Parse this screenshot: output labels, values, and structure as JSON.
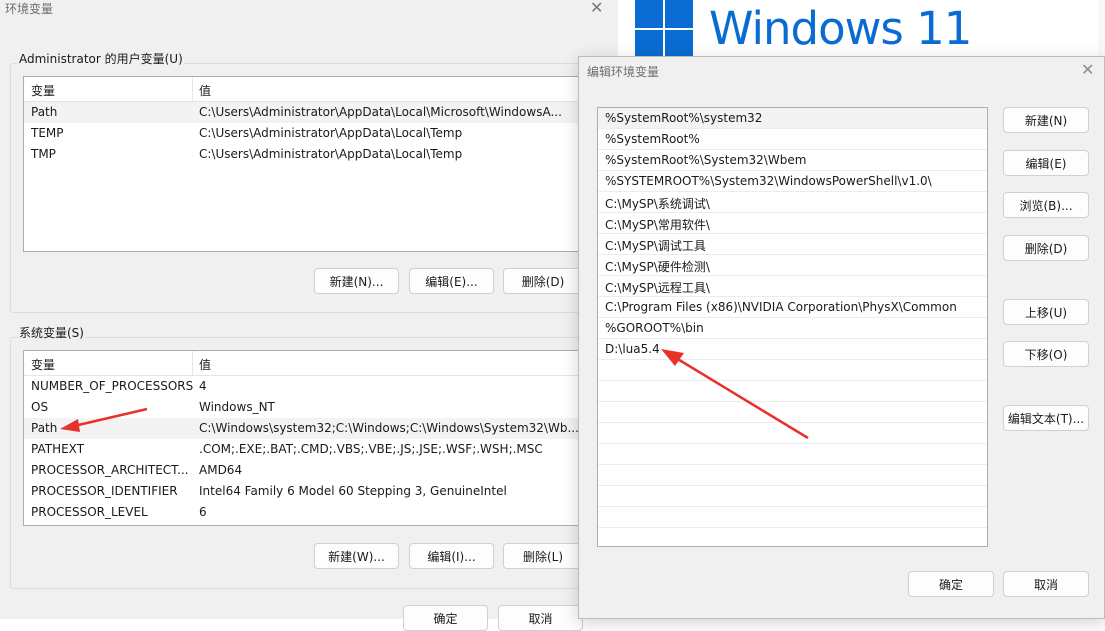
{
  "env_window": {
    "title": "环境变量",
    "close_glyph": "✕",
    "user_group_label": "Administrator 的用户变量(U)",
    "system_group_label": "系统变量(S)",
    "column_variable": "变量",
    "column_value": "值",
    "user_vars": [
      {
        "name": "Path",
        "value": "C:\\Users\\Administrator\\AppData\\Local\\Microsoft\\WindowsA..."
      },
      {
        "name": "TEMP",
        "value": "C:\\Users\\Administrator\\AppData\\Local\\Temp"
      },
      {
        "name": "TMP",
        "value": "C:\\Users\\Administrator\\AppData\\Local\\Temp"
      }
    ],
    "system_vars": [
      {
        "name": "NUMBER_OF_PROCESSORS",
        "value": "4"
      },
      {
        "name": "OS",
        "value": "Windows_NT"
      },
      {
        "name": "Path",
        "value": "C:\\Windows\\system32;C:\\Windows;C:\\Windows\\System32\\Wb..."
      },
      {
        "name": "PATHEXT",
        "value": ".COM;.EXE;.BAT;.CMD;.VBS;.VBE;.JS;.JSE;.WSF;.WSH;.MSC"
      },
      {
        "name": "PROCESSOR_ARCHITECT...",
        "value": "AMD64"
      },
      {
        "name": "PROCESSOR_IDENTIFIER",
        "value": "Intel64 Family 6 Model 60 Stepping 3, GenuineIntel"
      },
      {
        "name": "PROCESSOR_LEVEL",
        "value": "6"
      }
    ],
    "user_buttons": {
      "new": "新建(N)...",
      "edit": "编辑(E)...",
      "delete": "删除(D)"
    },
    "system_buttons": {
      "new": "新建(W)...",
      "edit": "编辑(I)...",
      "delete": "删除(L)"
    },
    "ok": "确定",
    "cancel": "取消"
  },
  "banner": {
    "text": "Windows 11",
    "color": "#0a6cd2"
  },
  "edit_dialog": {
    "title": "编辑环境变量",
    "close_glyph": "✕",
    "paths": [
      "%SystemRoot%\\system32",
      "%SystemRoot%",
      "%SystemRoot%\\System32\\Wbem",
      "%SYSTEMROOT%\\System32\\WindowsPowerShell\\v1.0\\",
      "C:\\MySP\\系统调试\\",
      "C:\\MySP\\常用软件\\",
      "C:\\MySP\\调试工具",
      "C:\\MySP\\硬件检测\\",
      "C:\\MySP\\远程工具\\",
      "C:\\Program Files (x86)\\NVIDIA Corporation\\PhysX\\Common",
      "%GOROOT%\\bin",
      "D:\\lua5.4"
    ],
    "buttons": {
      "new": "新建(N)",
      "edit": "编辑(E)",
      "browse": "浏览(B)...",
      "delete": "删除(D)",
      "up": "上移(U)",
      "down": "下移(O)",
      "edit_text": "编辑文本(T)...",
      "ok": "确定",
      "cancel": "取消"
    }
  },
  "annotation_color": "#e8312a"
}
